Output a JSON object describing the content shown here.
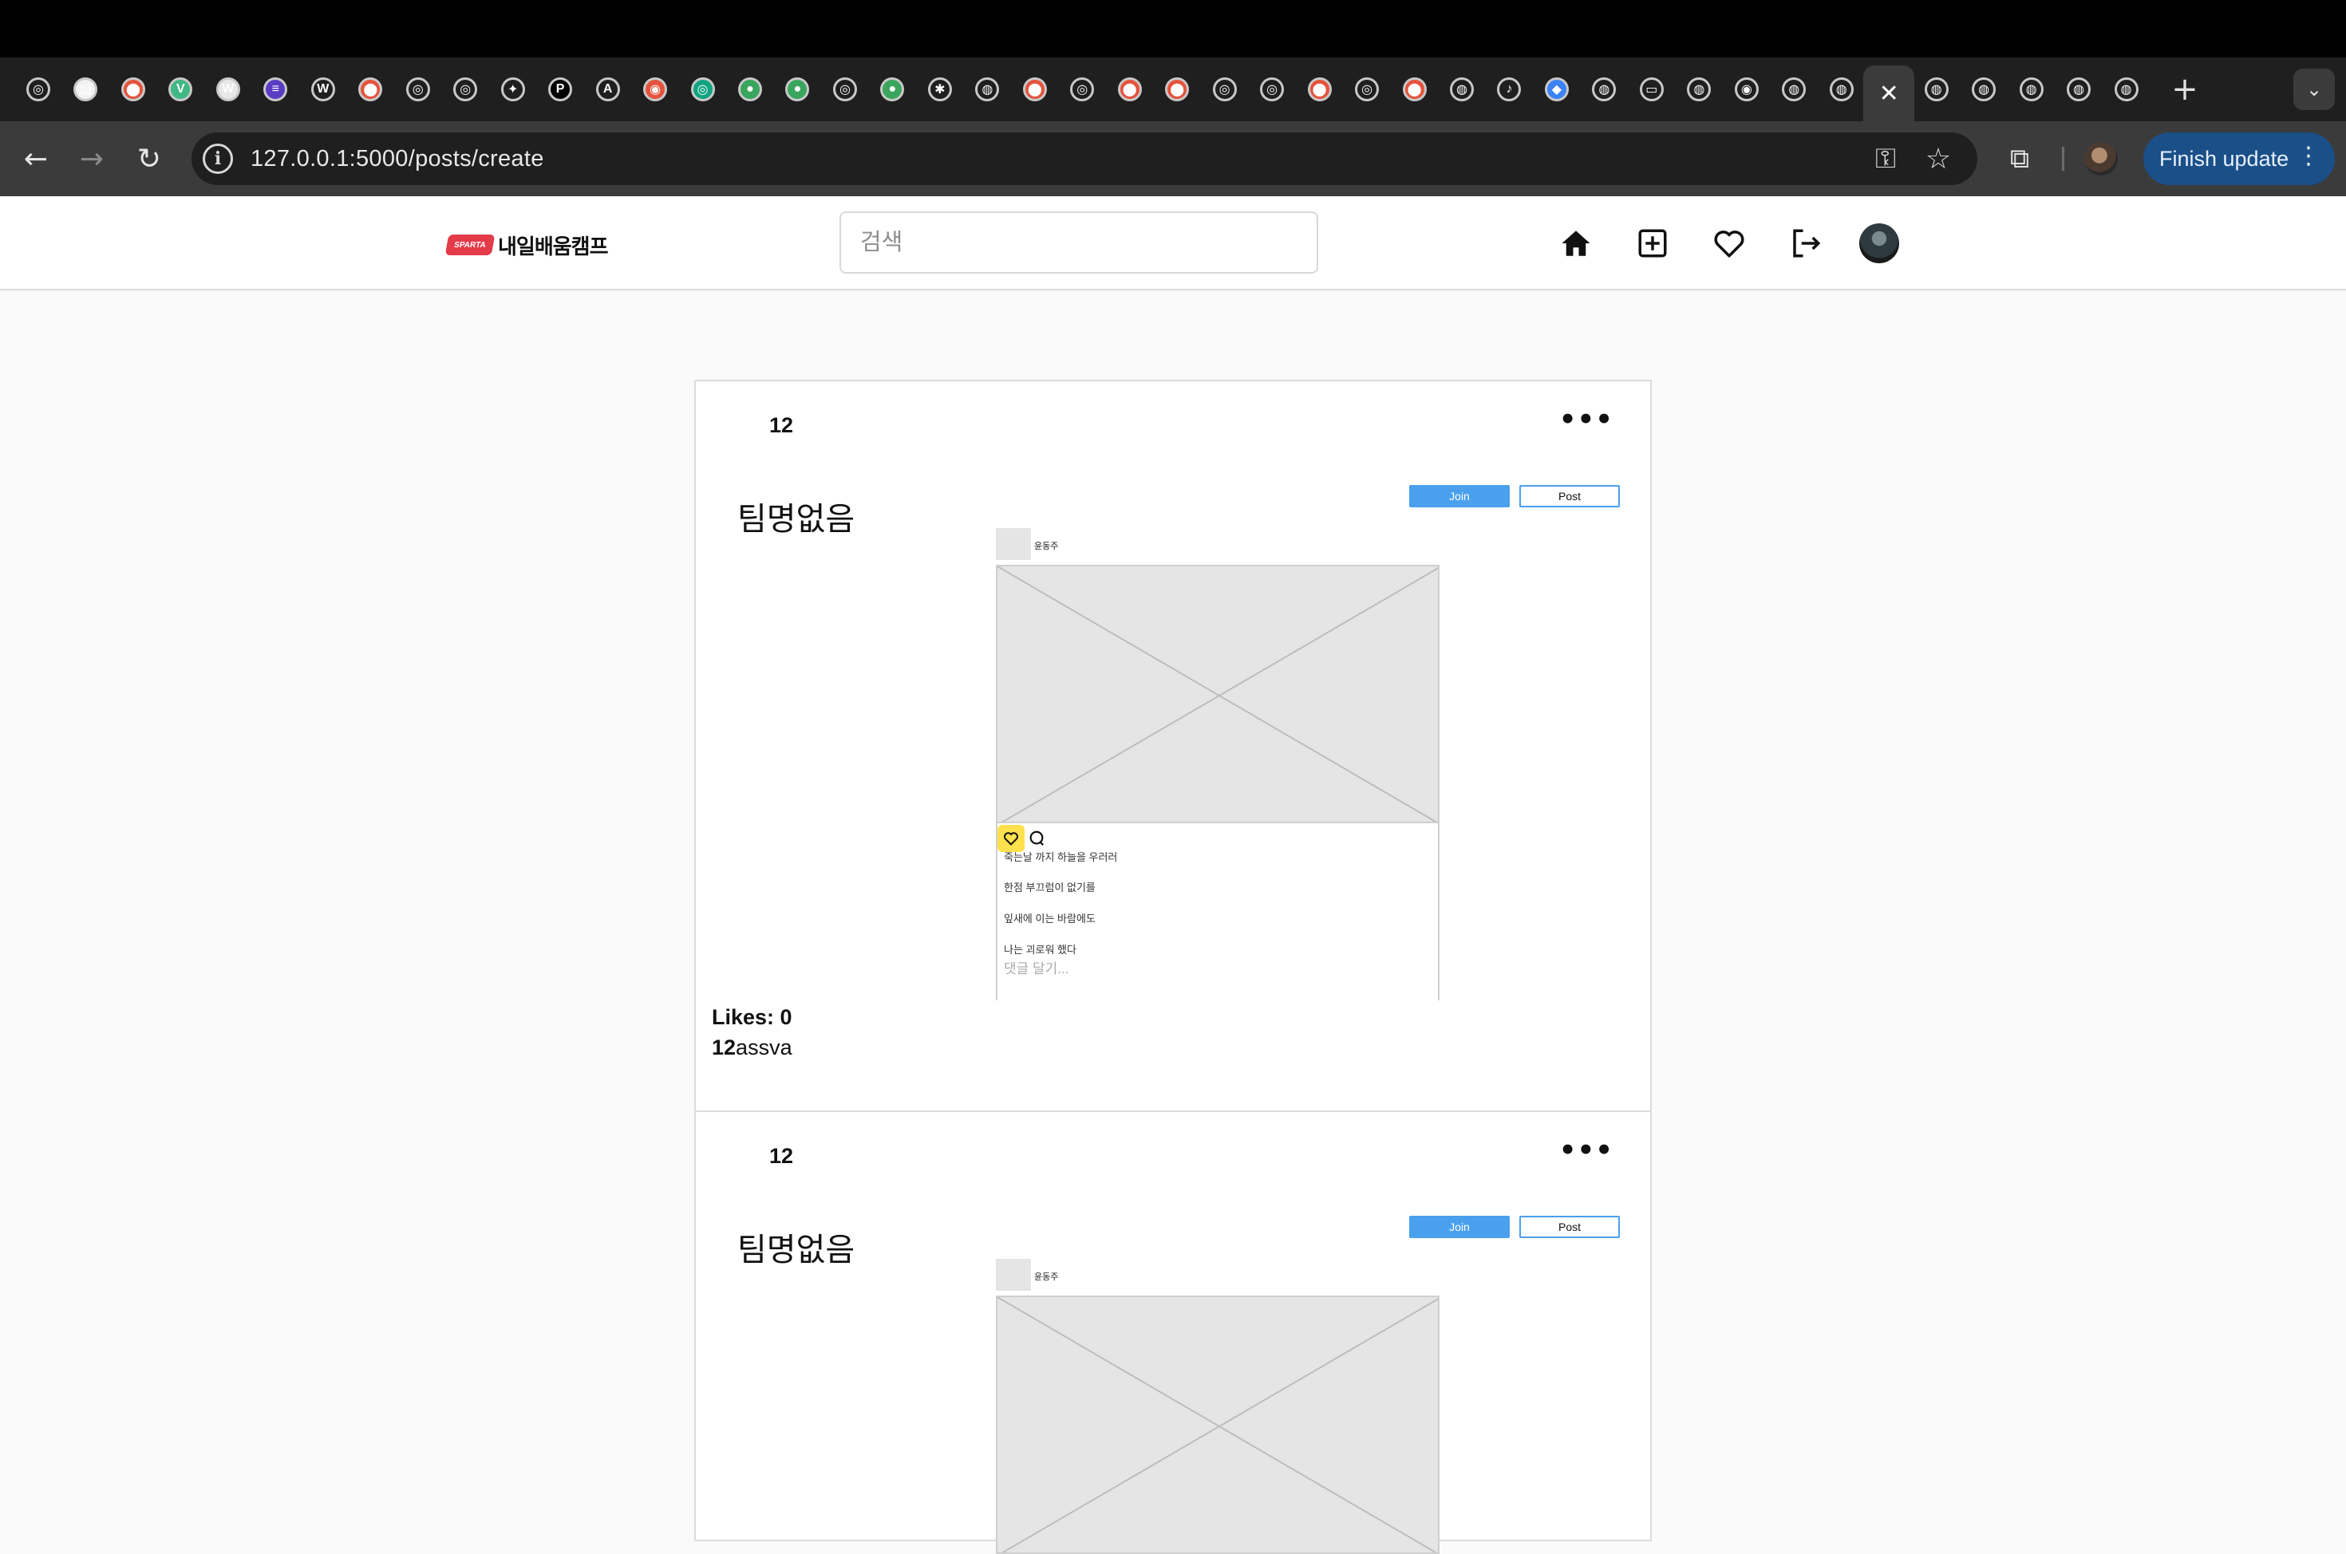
{
  "browser": {
    "url": "127.0.0.1:5000/posts/create",
    "finish_update_label": "Finish update",
    "tabs": [
      {
        "icon": "openai-icon"
      },
      {
        "icon": "note-icon"
      },
      {
        "icon": "red-app-icon"
      },
      {
        "icon": "vue-icon"
      },
      {
        "icon": "wordpress-icon"
      },
      {
        "icon": "list-app-icon"
      },
      {
        "icon": "w-app-icon"
      },
      {
        "icon": "red-app-icon"
      },
      {
        "icon": "openai-icon"
      },
      {
        "icon": "openai-icon"
      },
      {
        "icon": "gemini-icon"
      },
      {
        "icon": "p-app-icon"
      },
      {
        "icon": "a-app-icon"
      },
      {
        "icon": "red-globe-icon"
      },
      {
        "icon": "chatgpt-icon"
      },
      {
        "icon": "green-app-icon"
      },
      {
        "icon": "green-app-icon"
      },
      {
        "icon": "openai-icon"
      },
      {
        "icon": "green-app-icon"
      },
      {
        "icon": "slack-icon"
      },
      {
        "icon": "globe-icon"
      },
      {
        "icon": "red-app-icon"
      },
      {
        "icon": "openai-icon"
      },
      {
        "icon": "red-app-icon"
      },
      {
        "icon": "red-app-icon"
      },
      {
        "icon": "openai-icon"
      },
      {
        "icon": "openai-icon"
      },
      {
        "icon": "red-app-icon"
      },
      {
        "icon": "openai-icon"
      },
      {
        "icon": "red-app-icon"
      },
      {
        "icon": "globe-icon"
      },
      {
        "icon": "speaker-icon"
      },
      {
        "icon": "blue-app-icon"
      },
      {
        "icon": "globe-icon"
      },
      {
        "icon": "terminal-icon"
      },
      {
        "icon": "globe-icon"
      },
      {
        "icon": "chrome-icon"
      },
      {
        "icon": "globe-icon"
      },
      {
        "icon": "globe-icon"
      },
      {
        "icon": "close-icon"
      },
      {
        "icon": "globe-icon"
      },
      {
        "icon": "globe-icon"
      },
      {
        "icon": "globe-icon"
      },
      {
        "icon": "globe-icon"
      },
      {
        "icon": "globe-icon"
      }
    ]
  },
  "site": {
    "logo_badge": "SPARTA",
    "logo_text": "내일배움캠프",
    "search_placeholder": "검색"
  },
  "posts": [
    {
      "author": "12",
      "more": "•••",
      "team_name": "팀명없음",
      "join_label": "Join",
      "post_label": "Post",
      "wf_name": "윤동주",
      "wf_lines": [
        "죽는날 까지 하늘을 우러러",
        "한점 부끄럼이 없기를",
        "잎새에 이는 바람에도",
        "나는 괴로워 했다"
      ],
      "wf_comment_placeholder": "댓글 달기...",
      "likes": "Likes: 0",
      "caption_user": "12",
      "caption_text": "assva"
    },
    {
      "author": "12",
      "more": "•••",
      "team_name": "팀명없음",
      "join_label": "Join",
      "post_label": "Post",
      "wf_name": "윤동주"
    }
  ]
}
